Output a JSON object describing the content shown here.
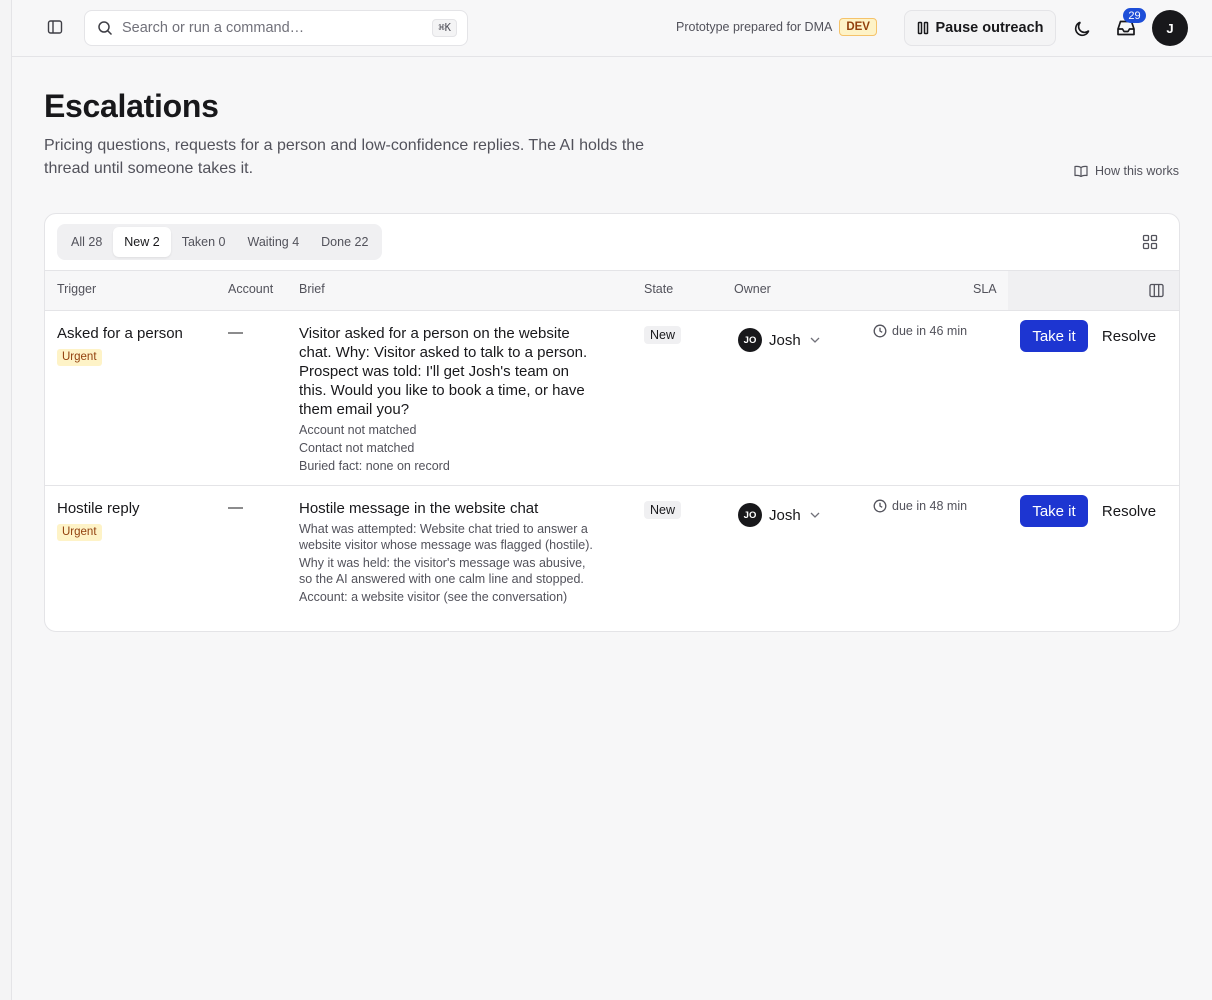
{
  "topbar": {
    "search": {
      "placeholder": "Search or run a command…",
      "shortcut": "⌘K"
    },
    "prototype_note": "Prototype prepared for DMA",
    "env_badge": "DEV",
    "pause_label": "Pause outreach",
    "inbox_count": "29",
    "avatar_initial": "J"
  },
  "page": {
    "title": "Escalations",
    "subtitle": "Pricing questions, requests for a person and low-confidence replies. The AI holds the thread until someone takes it.",
    "how_link": "How this works"
  },
  "tabs": [
    {
      "label": "All 28"
    },
    {
      "label": "New 2"
    },
    {
      "label": "Taken 0"
    },
    {
      "label": "Waiting 4"
    },
    {
      "label": "Done 22"
    }
  ],
  "table": {
    "headers": {
      "trigger": "Trigger",
      "account": "Account",
      "brief": "Brief",
      "state": "State",
      "owner": "Owner",
      "sla": "SLA"
    },
    "rows": [
      {
        "trigger": "Asked for a person",
        "priority": "Urgent",
        "account": "—",
        "brief": "Visitor asked for a person on the website chat. Why: Visitor asked to talk to a person. Prospect was told: I'll get Josh's team on this. Would you like to book a time, or have them email you?",
        "details": [
          "Account not matched",
          "Contact not matched",
          "Buried fact: none on record"
        ],
        "state": "New",
        "owner_initials": "JO",
        "owner_name": "Josh",
        "sla": "due in 46 min",
        "take_label": "Take it",
        "resolve_label": "Resolve"
      },
      {
        "trigger": "Hostile reply",
        "priority": "Urgent",
        "account": "—",
        "brief": "Hostile message in the website chat",
        "details": [
          "What was attempted: Website chat tried to answer a website visitor whose message was flagged (hostile).",
          "Why it was held: the visitor's message was abusive, so the AI answered with one calm line and stopped.",
          "Account: a website visitor (see the conversation)"
        ],
        "state": "New",
        "owner_initials": "JO",
        "owner_name": "Josh",
        "sla": "due in 48 min",
        "take_label": "Take it",
        "resolve_label": "Resolve"
      }
    ]
  },
  "colors": {
    "primary": "#1d35d1",
    "urgent_bg": "#fef3c7",
    "urgent_text": "#92400e",
    "badge": "#1d4ed8"
  }
}
